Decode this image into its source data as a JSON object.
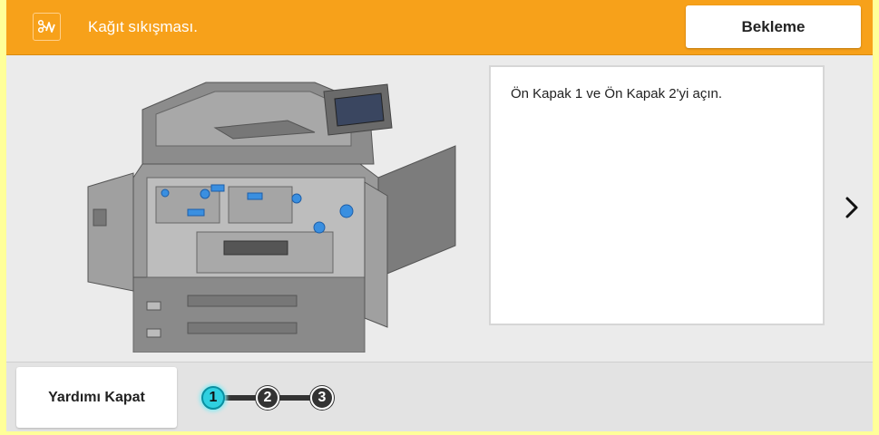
{
  "header": {
    "title": "Kağıt sıkışması.",
    "wait_label": "Bekleme",
    "icon": "paper-jam-icon"
  },
  "main": {
    "instruction": "Ön Kapak 1 ve Ön Kapak 2'yi açın.",
    "next_icon": "chevron-right-icon",
    "illustration": "printer-front-covers-open-illustration"
  },
  "footer": {
    "close_help_label": "Yardımı Kapat",
    "steps": [
      {
        "label": "1",
        "active": true
      },
      {
        "label": "2",
        "active": false
      },
      {
        "label": "3",
        "active": false
      }
    ]
  },
  "colors": {
    "header_bg": "#f7a11a",
    "step_active": "#2fd0e0",
    "step_inactive": "#333333",
    "outer_bg": "#ffff99"
  }
}
